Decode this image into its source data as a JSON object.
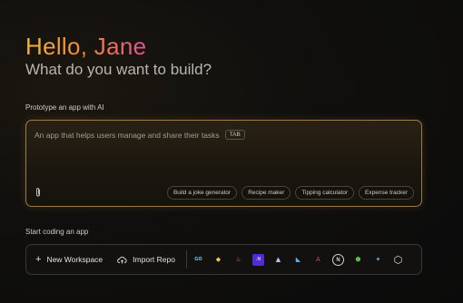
{
  "greeting": "Hello, Jane",
  "subtitle": "What do you want to build?",
  "prototype": {
    "label": "Prototype an app with AI",
    "input_text": "An app that helps users manage and share their tasks",
    "tab_key": "TAB",
    "attach_icon": "paperclip-icon",
    "suggestions": [
      "Build a joke generator",
      "Recipe maker",
      "Tipping calculator",
      "Expense tracker"
    ]
  },
  "coding": {
    "label": "Start coding an app",
    "new_workspace": "New Workspace",
    "import_repo": "Import Repo",
    "templates": [
      {
        "name": "go-icon",
        "glyph": "GO",
        "color": "#5fc9e3"
      },
      {
        "name": "python-icon",
        "glyph": "◆",
        "color": "#f2c94c"
      },
      {
        "name": "java-icon",
        "glyph": "♨",
        "color": "#e07a3a"
      },
      {
        "name": "dotnet-icon",
        "glyph": ".N",
        "color": "#7b5cd6"
      },
      {
        "name": "astro-icon",
        "glyph": "▲",
        "color": "#b8c7ff"
      },
      {
        "name": "flutter-icon",
        "glyph": "◣",
        "color": "#54b8f0"
      },
      {
        "name": "angular-icon",
        "glyph": "A",
        "color": "#e0405e"
      },
      {
        "name": "next-icon",
        "glyph": "N",
        "color": "#ffffff"
      },
      {
        "name": "node-icon",
        "glyph": "⬢",
        "color": "#5fb84a"
      },
      {
        "name": "gemini-icon",
        "glyph": "✦",
        "color": "#6fa8ff"
      },
      {
        "name": "settings-hex-icon",
        "glyph": "⬡",
        "color": "#e0e0e0"
      }
    ]
  }
}
